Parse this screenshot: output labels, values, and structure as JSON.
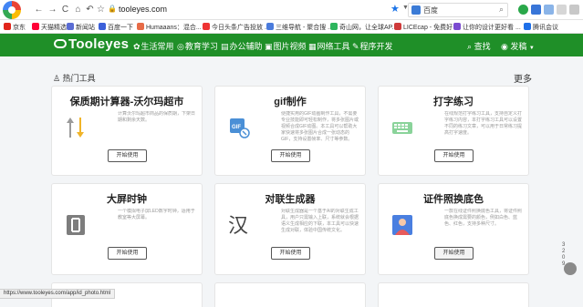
{
  "browser": {
    "back": "←",
    "forward": "→",
    "reload": "C",
    "home": "⌂",
    "undo": "↶",
    "bookmark": "☆",
    "lock": "🔒",
    "url": "tooleyes.com",
    "star": "★",
    "search_engine_label": "百度",
    "search_icon": "magnifier-icon"
  },
  "bookmarks": [
    {
      "label": "京东",
      "color": "#e1251b"
    },
    {
      "label": "天猫精选",
      "color": "#ff0036"
    },
    {
      "label": "新闻站",
      "color": "#5a6cd3"
    },
    {
      "label": "百度一下",
      "color": "#3b5fd9"
    },
    {
      "label": "Humaaans：混合...",
      "color": "#e76b47"
    },
    {
      "label": "今日头条广告投放 ...",
      "color": "#e33"
    },
    {
      "label": "三维导航 - 聚合搜 ...",
      "color": "#4a7bdc"
    },
    {
      "label": "奇山网，让全球AP...",
      "color": "#2db55d"
    },
    {
      "label": "LICEcap - 免费好 ...",
      "color": "#cf3a3a"
    },
    {
      "label": "让你的设计更好看 ...",
      "color": "#7a4bd0"
    },
    {
      "label": "腾讯会议",
      "color": "#1e6fe8"
    }
  ],
  "site": {
    "brand": "Tooleyes",
    "nav": [
      {
        "icon": "✿",
        "label": "生活常用"
      },
      {
        "icon": "◎",
        "label": "教育学习"
      },
      {
        "icon": "▤",
        "label": "办公辅助"
      },
      {
        "icon": "▣",
        "label": "图片视频"
      },
      {
        "icon": "▦",
        "label": "网络工具"
      },
      {
        "icon": "✎",
        "label": "程序开发"
      }
    ],
    "search": "查找",
    "post": "发稿"
  },
  "section": {
    "title": "热门工具",
    "more": "更多"
  },
  "cards": [
    {
      "title": "保质期计算器-沃尔玛超市",
      "desc": "计算沃尔玛超市商品的保质期，下架日期和剩余天数。",
      "button": "开始使用"
    },
    {
      "title": "gif制作",
      "desc": "便捷实用的GIF动画制作工具，不需要专业技能即可轻松制作，将多张图片或视频合成GIF动图。本工具可以帮助大家快速将多张图片合成一张动态的GIF，支持设置帧率、尺寸等参数。",
      "button": "开始使用"
    },
    {
      "title": "打字练习",
      "desc": "在线规范打字练习工具，支持自定义打字练习内容，本打字练习工具可以设置不同的练习文章，可以用于日常练习提高打字速度。",
      "button": "开始使用"
    },
    {
      "title": "大屏时钟",
      "desc": "一个模拟电子屏LED数字时钟，适用于教室等大屏幕。",
      "button": "开始使用"
    },
    {
      "title": "对联生成器",
      "desc": "对联生成器是一个基于AI的对联生成工具，用户只需输入上联，系统就会根据语义生成相应的下联，本工具可以快速生成对联，体验中国传统文化。",
      "button": "开始使用"
    },
    {
      "title": "证件照换底色",
      "desc": "一款在线证件照换底色工具，将证件照底色换成需要的颜色，例如白色、蓝色、红色，支持多种尺寸。",
      "button": "开始使用"
    }
  ],
  "side": {
    "label": "3\n2\n0\n9"
  },
  "status": "https://www.tooleyes.com/app/id_photo.html"
}
